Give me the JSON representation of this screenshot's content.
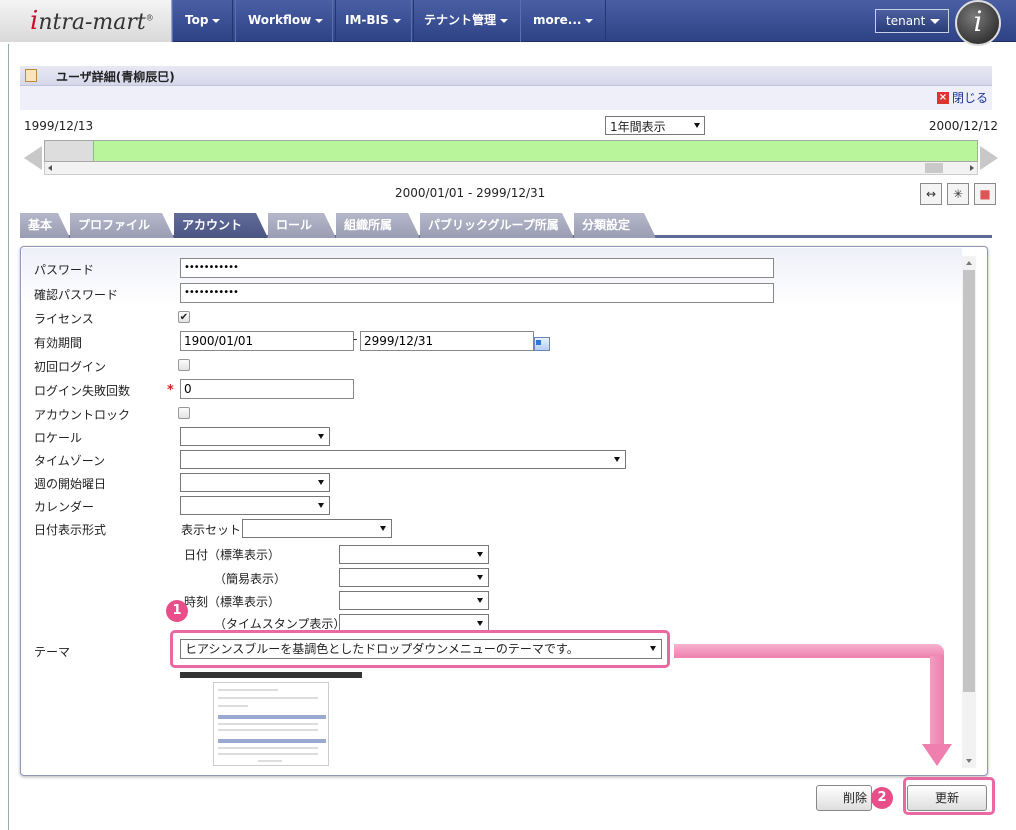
{
  "navbar": {
    "logo_lead": "i",
    "logo_text": "ntra-mart",
    "logo_mark": "®",
    "items": [
      {
        "label": "Top"
      },
      {
        "label": "Workflow"
      },
      {
        "label": "IM-BIS"
      },
      {
        "label": "テナント管理"
      },
      {
        "label": "more..."
      }
    ],
    "tenant_label": "tenant",
    "avatar_letter": "i"
  },
  "page": {
    "title": "ユーザ詳細(青柳辰巳)",
    "close_label": "閉じる"
  },
  "timeline": {
    "start_date": "1999/12/13",
    "end_date": "2000/12/12",
    "period_select": "1年間表示",
    "range": "2000/01/01 - 2999/12/31"
  },
  "tabs": [
    {
      "label": "基本"
    },
    {
      "label": "プロファイル"
    },
    {
      "label": "アカウント"
    },
    {
      "label": "ロール"
    },
    {
      "label": "組織所属"
    },
    {
      "label": "パブリックグループ所属"
    },
    {
      "label": "分類設定"
    }
  ],
  "form": {
    "password_label": "パスワード",
    "password_value": "•••••••••••",
    "confirm_label": "確認パスワード",
    "confirm_value": "•••••••••••",
    "license_label": "ライセンス",
    "license_checked": "✔",
    "valid_label": "有効期間",
    "valid_from": "1900/01/01",
    "valid_sep": "-",
    "valid_to": "2999/12/31",
    "first_login_label": "初回ログイン",
    "fail_count_label": "ログイン失敗回数",
    "fail_count_value": "0",
    "required_mark": "*",
    "lock_label": "アカウントロック",
    "locale_label": "ロケール",
    "timezone_label": "タイムゾーン",
    "week_start_label": "週の開始曜日",
    "calendar_label": "カレンダー",
    "date_format_label": "日付表示形式",
    "display_set_label": "表示セット",
    "date_std_label": "日付（標準表示）",
    "date_simple_label": "（簡易表示）",
    "time_std_label": "時刻（標準表示）",
    "time_stamp_label": "（タイムスタンプ表示）",
    "theme_label": "テーマ",
    "theme_value": "ヒアシンスブルーを基調色としたドロップダウンメニューのテーマです。"
  },
  "annotations": {
    "badge1": "1",
    "badge2": "2"
  },
  "buttons": {
    "delete_label": "削除",
    "update_label": "更新"
  },
  "colors": {
    "navbar": "#2e4385",
    "highlight": "#e86aa0",
    "timeline_bar": "#b8f59b",
    "active_tab": "#4b5583"
  }
}
